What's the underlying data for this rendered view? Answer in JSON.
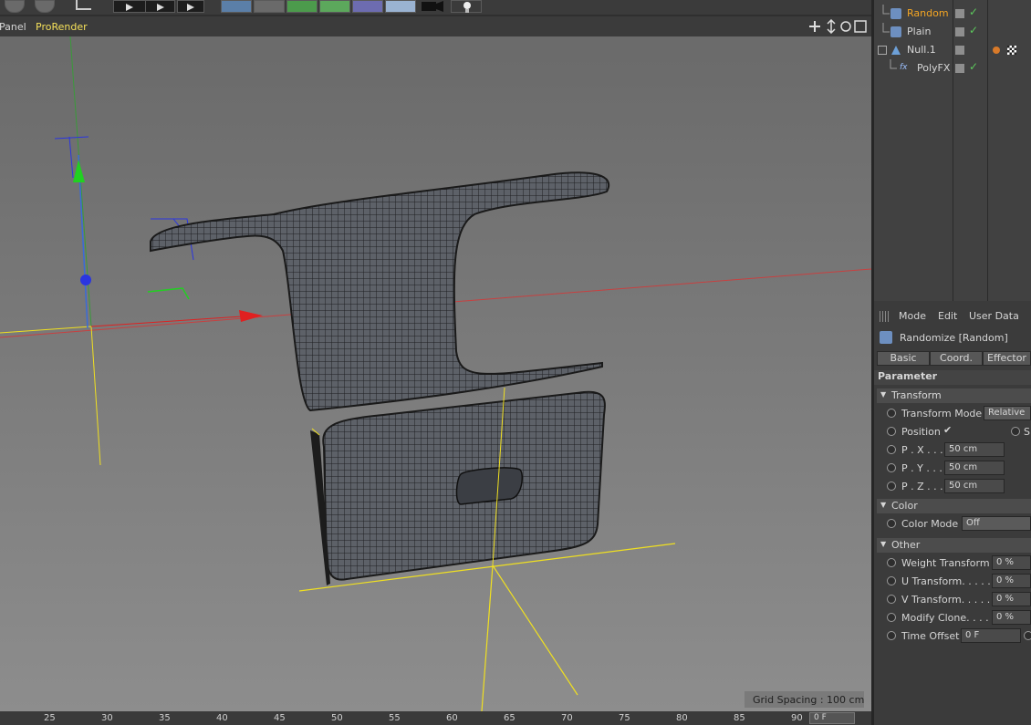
{
  "viewport_menu": {
    "panel": "Panel",
    "prorender": "ProRender"
  },
  "viewport": {
    "grid_spacing": "Grid Spacing : 100 cm"
  },
  "timeline": {
    "ticks": [
      "25",
      "30",
      "35",
      "40",
      "45",
      "50",
      "55",
      "60",
      "65",
      "70",
      "75",
      "80",
      "85",
      "90"
    ],
    "frame": "0 F"
  },
  "objects": [
    {
      "name": "Random",
      "active": true
    },
    {
      "name": "Plain",
      "active": false
    },
    {
      "name": "Null.1",
      "active": false
    },
    {
      "name": "PolyFX",
      "active": false
    }
  ],
  "attributes": {
    "menu": [
      "Mode",
      "Edit",
      "User Data"
    ],
    "object_title": "Randomize [Random]",
    "tabs": [
      "Basic",
      "Coord.",
      "Effector"
    ],
    "parameter_header": "Parameter",
    "transform": {
      "section": "Transform",
      "mode_label": "Transform Mode",
      "mode_value": "Relative",
      "position_label": "Position",
      "position_check": "✔",
      "scale_label": "S",
      "px_label": "P . X . . . .",
      "px_value": "50 cm",
      "py_label": "P . Y . . . .",
      "py_value": "50 cm",
      "pz_label": "P . Z . . . .",
      "pz_value": "50 cm"
    },
    "color": {
      "section": "Color",
      "mode_label": "Color Mode",
      "mode_value": "Off"
    },
    "other": {
      "section": "Other",
      "weight_label": "Weight Transform",
      "weight_value": "0 %",
      "u_label": "U Transform. . . . .",
      "u_value": "0 %",
      "v_label": "V Transform. . . . .",
      "v_value": "0 %",
      "modify_label": "Modify Clone. . . .",
      "modify_value": "0 %",
      "time_label": "Time Offset",
      "time_value": "0 F"
    }
  },
  "colors": {
    "active_object": "#f5a623",
    "accent_yellow": "#f0e020",
    "axis_x": "#e02020",
    "axis_y": "#20c020",
    "axis_z": "#2040e0"
  }
}
